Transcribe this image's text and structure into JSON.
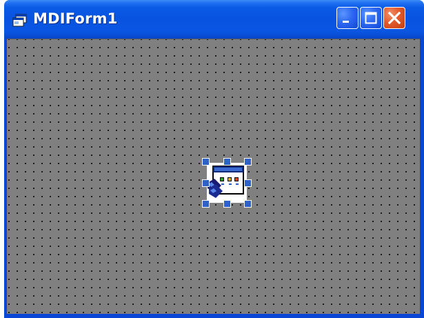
{
  "window": {
    "title": "MDIForm1",
    "buttons": {
      "minimize": "minimize-icon",
      "maximize": "maximize-icon",
      "close": "close-icon"
    }
  },
  "designer": {
    "grid": "dotted",
    "background_color": "#808080",
    "selected_control": {
      "icon": "imagelist-control-icon",
      "selected": true
    }
  },
  "colors": {
    "titlebar": "#0a5ae6",
    "close_button": "#e25a2b",
    "selection_handle": "#2f62c8"
  }
}
